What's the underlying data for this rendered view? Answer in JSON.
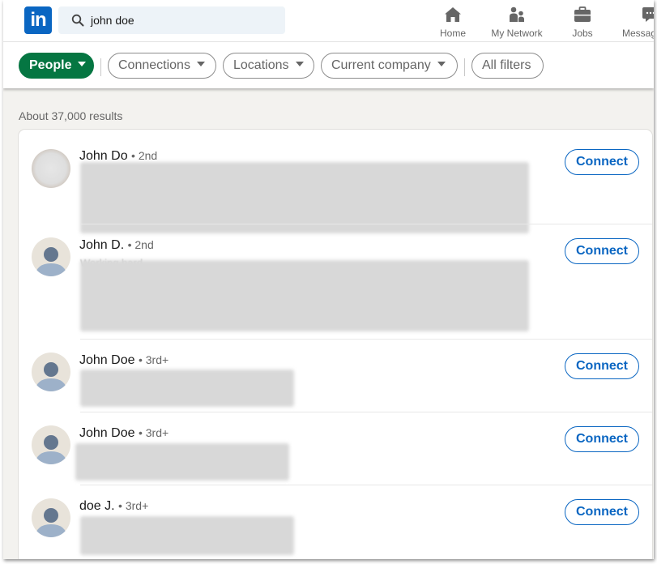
{
  "nav": {
    "logo": "in",
    "search_value": "john doe",
    "items": [
      {
        "label": "Home",
        "icon": "home-icon"
      },
      {
        "label": "My Network",
        "icon": "my-network-icon"
      },
      {
        "label": "Jobs",
        "icon": "jobs-icon"
      },
      {
        "label": "Messaging",
        "icon": "messaging-icon"
      }
    ]
  },
  "filters": {
    "people": "People",
    "connections": "Connections",
    "locations": "Locations",
    "current_company": "Current company",
    "all_filters": "All filters"
  },
  "results_count": "About 37,000 results",
  "results": [
    {
      "name": "John Do",
      "degree": "• 2nd",
      "headline": "",
      "connect": "Connect",
      "avatar": "photo"
    },
    {
      "name": "John D.",
      "degree": "• 2nd",
      "headline": "Working hard",
      "connect": "Connect",
      "avatar": "default"
    },
    {
      "name": "John Doe",
      "degree": "• 3rd+",
      "headline": "",
      "connect": "Connect",
      "avatar": "default"
    },
    {
      "name": "John Doe",
      "degree": "• 3rd+",
      "headline": "",
      "connect": "Connect",
      "avatar": "default"
    },
    {
      "name": "doe J.",
      "degree": "• 3rd+",
      "headline": "",
      "connect": "Connect",
      "avatar": "default"
    }
  ],
  "colors": {
    "brand_blue": "#0a66c2",
    "people_green": "#057642",
    "background": "#f3f2ef"
  }
}
